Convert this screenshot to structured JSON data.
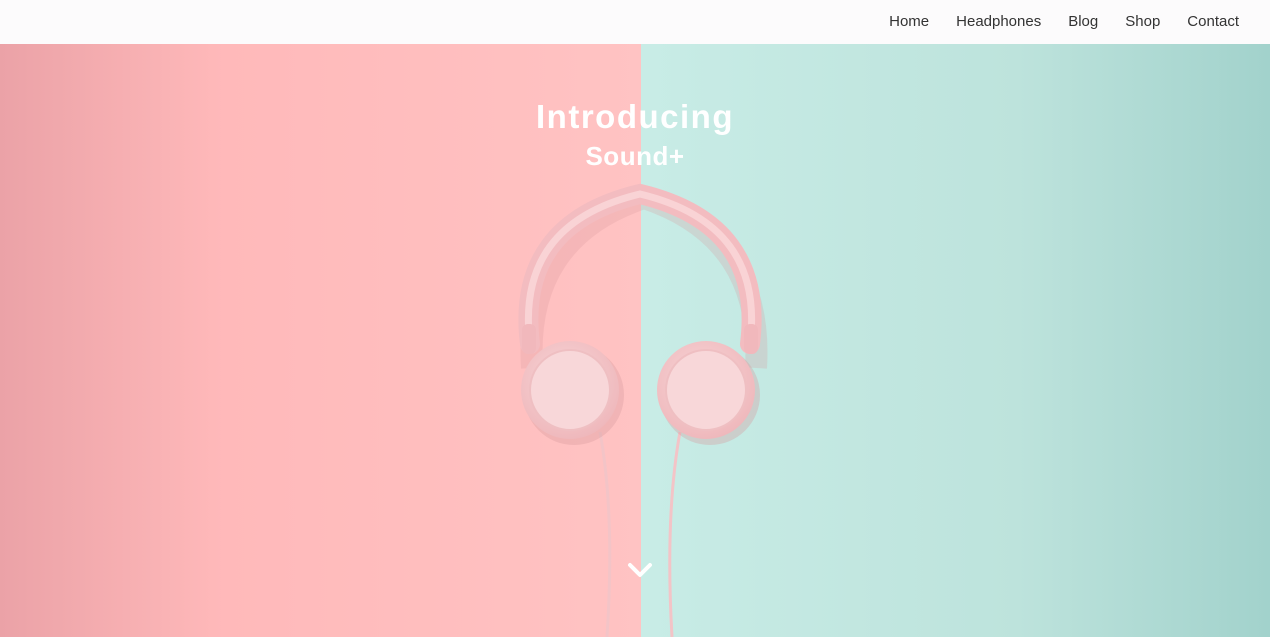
{
  "nav": {
    "items": [
      {
        "label": "Home"
      },
      {
        "label": "Headphones"
      },
      {
        "label": "Blog"
      },
      {
        "label": "Shop"
      },
      {
        "label": "Contact"
      }
    ]
  },
  "hero": {
    "title_line1": "Introducing",
    "title_line2": "Sound+",
    "scroll_icon": "chevron-down-icon"
  },
  "colors": {
    "navbar_bg": "#fcfbfc",
    "nav_text": "#333333",
    "left_panel": "#ffc0c0",
    "right_panel": "#c5e9e2",
    "headphone": "#f6c9cc",
    "title_text": "#ffffff"
  }
}
